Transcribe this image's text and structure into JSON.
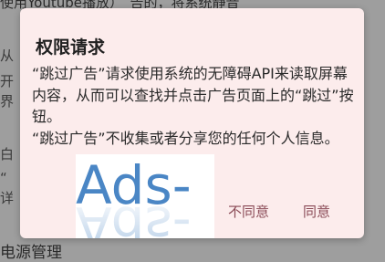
{
  "background": {
    "top_text": "使用Youtube播放）　告的，将系统静音",
    "side_fragments": [
      "从",
      "开",
      "界",
      "白",
      "“",
      "详"
    ],
    "bottom_text": "电源管理"
  },
  "dialog": {
    "title": "权限请求",
    "body_line_1": "“跳过广告”请求使用系统的无障碍API来读取屏幕内容，从而可以查找并点击广告页面上的“跳过”按钮。",
    "body_line_2": "“跳过广告”不收集或者分享您的任何个人信息。",
    "logo_text": "Ads-",
    "deny_label": "不同意",
    "allow_label": "同意"
  },
  "colors": {
    "dialog_bg": "#fcecec",
    "accent": "#8a4a56",
    "logo_blue": "#4a86c5"
  }
}
